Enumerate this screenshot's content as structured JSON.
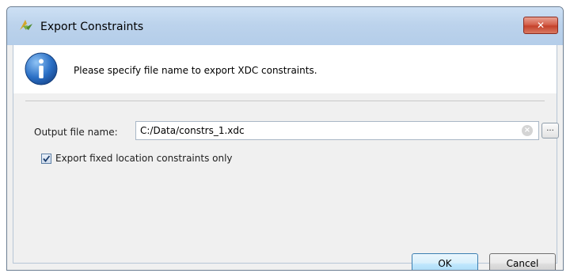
{
  "dialog": {
    "title": "Export Constraints",
    "close_label": "✕",
    "message": "Please specify file name to export XDC constraints.",
    "output_label": "Output file name:",
    "output_value": "C:/Data/constrs_1.xdc",
    "browse_label": "...",
    "clear_icon": "×",
    "export_fixed_label": "Export fixed location constraints only",
    "export_fixed_checked": true,
    "ok_label": "OK",
    "cancel_label": "Cancel"
  },
  "icons": {
    "app": "vivado-logo-icon",
    "info": "info-icon",
    "close": "close-icon"
  },
  "colors": {
    "titlebar": "#bcd3ec",
    "close_button": "#c5422c",
    "info_blue": "#1f5fb3",
    "dialog_bg": "#f0f0f0"
  }
}
